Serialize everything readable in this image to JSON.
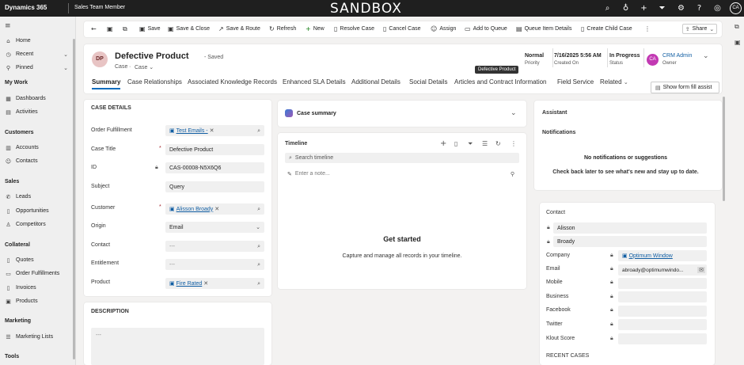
{
  "topbar": {
    "brand": "Dynamics 365",
    "app": "Sales Team Member",
    "env": "SANDBOX",
    "avatar": "CA"
  },
  "nav": {
    "home": "Home",
    "recent": "Recent",
    "pinned": "Pinned",
    "my_work": "My Work",
    "dashboards": "Dashboards",
    "activities": "Activities",
    "customers": "Customers",
    "accounts": "Accounts",
    "contacts": "Contacts",
    "sales": "Sales",
    "leads": "Leads",
    "opportunities": "Opportunities",
    "competitors": "Competitors",
    "collateral": "Collateral",
    "quotes": "Quotes",
    "order_fulfillments": "Order Fulfillments",
    "invoices": "Invoices",
    "products": "Products",
    "marketing": "Marketing",
    "marketing_lists": "Marketing Lists",
    "tools": "Tools"
  },
  "commands": {
    "save": "Save",
    "save_close": "Save & Close",
    "save_route": "Save & Route",
    "refresh": "Refresh",
    "new": "New",
    "resolve": "Resolve Case",
    "cancel": "Cancel Case",
    "assign": "Assign",
    "add_queue": "Add to Queue",
    "queue_details": "Queue Item Details",
    "child_case": "Create Child Case",
    "share": "Share"
  },
  "record": {
    "initials": "DP",
    "title": "Defective Product",
    "saved": "- Saved",
    "entity": "Case",
    "form": "Case",
    "tooltip": "Defective Product",
    "priority_val": "Normal",
    "priority_lbl": "Priority",
    "created_val": "7/16/2025 5:56 AM",
    "created_lbl": "Created On",
    "status_val": "In Progress",
    "status_lbl": "Status",
    "owner_initials": "CA",
    "owner_val": "CRM Admin",
    "owner_lbl": "Owner"
  },
  "tabs": [
    "Summary",
    "Case Relationships",
    "Associated Knowledge Records",
    "Enhanced SLA Details",
    "Additional Details",
    "Social Details",
    "Articles and Contract Information",
    "Field Service",
    "Related"
  ],
  "form_fill": "Show form fill assist",
  "case_details": {
    "heading": "CASE DETAILS",
    "order_label": "Order Fulfillment",
    "order_value": "Test Emails -",
    "title_label": "Case Title",
    "title_value": "Defective Product",
    "id_label": "ID",
    "id_value": "CAS-00008-N5X6Q6",
    "subject_label": "Subject",
    "subject_value": "Query",
    "customer_label": "Customer",
    "customer_value": "Alisson Broady",
    "origin_label": "Origin",
    "origin_value": "Email",
    "contact_label": "Contact",
    "contact_value": "---",
    "entitlement_label": "Entitlement",
    "entitlement_value": "---",
    "product_label": "Product",
    "product_value": "Fire Rated",
    "required": "*"
  },
  "description": {
    "heading": "DESCRIPTION",
    "value": "---"
  },
  "case_summary": "Case summary",
  "timeline": {
    "heading": "Timeline",
    "search": "Search timeline",
    "note": "Enter a note...",
    "empty_title": "Get started",
    "empty_text": "Capture and manage all records in your timeline."
  },
  "assistant": {
    "heading": "Assistant",
    "notifications": "Notifications",
    "none": "No notifications or suggestions",
    "later": "Check back later to see what's new and stay up to date."
  },
  "contact": {
    "heading": "Contact",
    "first": "Alisson",
    "last": "Broady",
    "company_lbl": "Company",
    "company_val": "Optimum Window",
    "email_lbl": "Email",
    "email_val": "abroady@optimumwindo...",
    "mobile_lbl": "Mobile",
    "business_lbl": "Business",
    "facebook_lbl": "Facebook",
    "twitter_lbl": "Twitter",
    "klout_lbl": "Klout Score",
    "recent_cases": "RECENT CASES"
  }
}
